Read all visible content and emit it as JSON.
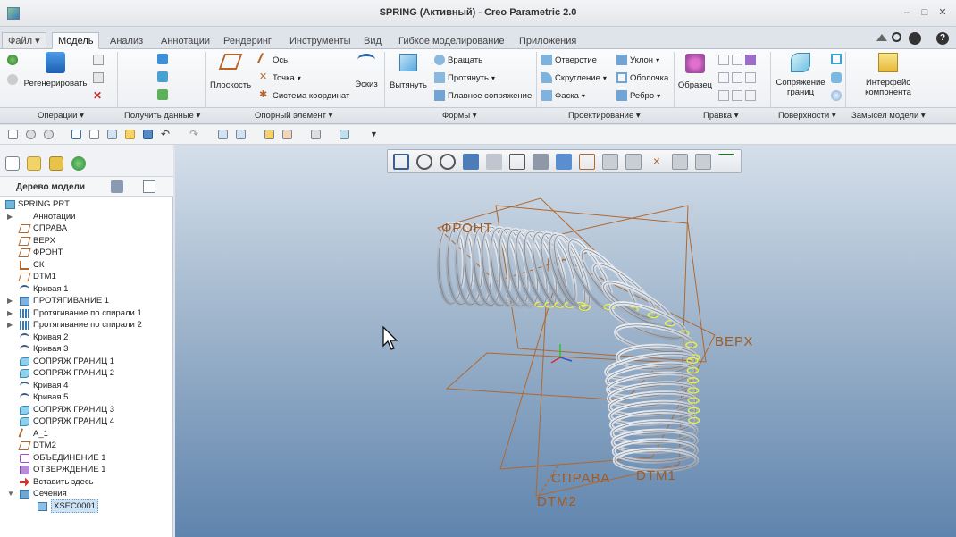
{
  "window": {
    "title": "SPRING (Активный) - Creo Parametric 2.0",
    "controls": [
      "–",
      "□",
      "✕"
    ]
  },
  "menu": {
    "file_label": "Файл ▾",
    "tabs": [
      "Модель",
      "Анализ",
      "Аннотации",
      "Рендеринг",
      "Инструменты",
      "Вид",
      "Гибкое моделирование",
      "Приложения"
    ],
    "active_tab": "Модель"
  },
  "ribbon": {
    "operations": {
      "regenerate": "Регенерировать"
    },
    "datum": {
      "plane": "Плоскость",
      "axis": "Ось",
      "point": "Точка",
      "coord": "Система координат",
      "sketch": "Эскиз"
    },
    "shapes": {
      "extrude": "Вытянуть",
      "revolve": "Вращать",
      "sweep": "Протянуть",
      "blend": "Плавное сопряжение"
    },
    "engineering": {
      "hole": "Отверстие",
      "round": "Скругление",
      "chamfer": "Фаска",
      "draft": "Уклон",
      "shell": "Оболочка",
      "rib": "Ребро"
    },
    "editing": {
      "pattern": "Образец"
    },
    "surfaces": {
      "boundary_line1": "Сопряжение",
      "boundary_line2": "границ"
    },
    "intent": {
      "interface_line1": "Интерфейс",
      "interface_line2": "компонента"
    },
    "groups": [
      "Операции ▾",
      "Получить данные ▾",
      "Опорный элемент ▾",
      "Формы ▾",
      "Проектирование ▾",
      "Правка ▾",
      "Поверхности ▾",
      "Замысел модели ▾"
    ]
  },
  "model_tree": {
    "title": "Дерево модели",
    "items": [
      {
        "label": "SPRING.PRT",
        "icon": "part-icon",
        "level": 0,
        "expand": ""
      },
      {
        "label": "Аннотации",
        "icon": "none",
        "level": 1,
        "expand": "▶"
      },
      {
        "label": "СПРАВА",
        "icon": "plane-icon",
        "level": 1,
        "expand": ""
      },
      {
        "label": "ВЕРХ",
        "icon": "plane-icon",
        "level": 1,
        "expand": ""
      },
      {
        "label": "ФРОНТ",
        "icon": "plane-icon",
        "level": 1,
        "expand": ""
      },
      {
        "label": "СК",
        "icon": "csys-icon",
        "level": 1,
        "expand": ""
      },
      {
        "label": "DTM1",
        "icon": "plane-icon",
        "level": 1,
        "expand": ""
      },
      {
        "label": "Кривая 1",
        "icon": "curve-icon",
        "level": 1,
        "expand": ""
      },
      {
        "label": "ПРОТЯГИВАНИЕ 1",
        "icon": "sweep-icon",
        "level": 1,
        "expand": "▶"
      },
      {
        "label": "Протягивание по спирали 1",
        "icon": "helical-sweep-icon",
        "level": 1,
        "expand": "▶"
      },
      {
        "label": "Протягивание по спирали 2",
        "icon": "helical-sweep-icon",
        "level": 1,
        "expand": "▶"
      },
      {
        "label": "Кривая 2",
        "icon": "curve-icon",
        "level": 1,
        "expand": ""
      },
      {
        "label": "Кривая 3",
        "icon": "curve-icon",
        "level": 1,
        "expand": ""
      },
      {
        "label": "СОПРЯЖ ГРАНИЦ 1",
        "icon": "boundary-blend-icon",
        "level": 1,
        "expand": ""
      },
      {
        "label": "СОПРЯЖ ГРАНИЦ 2",
        "icon": "boundary-blend-icon",
        "level": 1,
        "expand": ""
      },
      {
        "label": "Кривая 4",
        "icon": "curve-icon",
        "level": 1,
        "expand": ""
      },
      {
        "label": "Кривая 5",
        "icon": "curve-icon",
        "level": 1,
        "expand": ""
      },
      {
        "label": "СОПРЯЖ ГРАНИЦ 3",
        "icon": "boundary-blend-icon",
        "level": 1,
        "expand": ""
      },
      {
        "label": "СОПРЯЖ ГРАНИЦ 4",
        "icon": "boundary-blend-icon",
        "level": 1,
        "expand": ""
      },
      {
        "label": "A_1",
        "icon": "axis-icon",
        "level": 1,
        "expand": ""
      },
      {
        "label": "DTM2",
        "icon": "plane-icon",
        "level": 1,
        "expand": ""
      },
      {
        "label": "ОБЪЕДИНЕНИЕ 1",
        "icon": "merge-icon",
        "level": 1,
        "expand": ""
      },
      {
        "label": "ОТВЕРЖДЕНИЕ 1",
        "icon": "solidify-icon",
        "level": 1,
        "expand": ""
      },
      {
        "label": "Вставить здесь",
        "icon": "insert-here-icon",
        "level": 1,
        "expand": ""
      },
      {
        "label": "Сечения",
        "icon": "folder-icon",
        "level": 1,
        "expand": "▼"
      },
      {
        "label": "XSEC0001",
        "icon": "xsec-icon",
        "level": 2,
        "expand": "",
        "selected": true
      }
    ]
  },
  "viewport": {
    "datum_labels": {
      "front": "ФРОНТ",
      "top": "ВЕРХ",
      "right": "СПРАВА",
      "dtm1": "DTM1",
      "dtm2": "DTM2"
    }
  },
  "colors": {
    "datum": "#b0682f",
    "spring": "#dfe4ea",
    "highlight": "#e8f04a",
    "viewport_top": "#d5dfea",
    "viewport_bottom": "#5f84ad"
  }
}
